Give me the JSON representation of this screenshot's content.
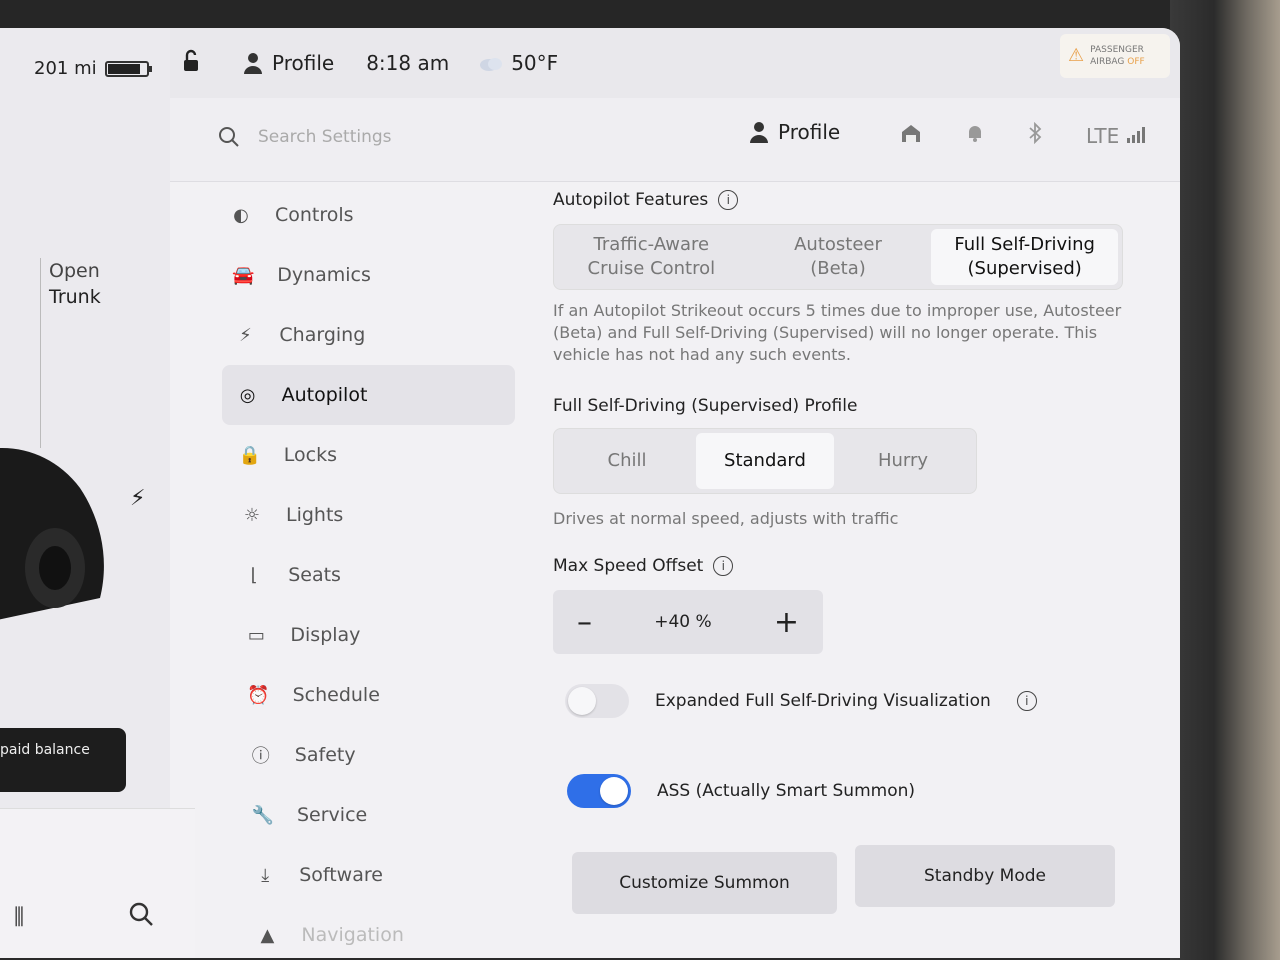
{
  "car_panel": {
    "range": "201 mi",
    "open_trunk_line1": "Open",
    "open_trunk_line2": "Trunk",
    "balance_button": "paid balance"
  },
  "topbar": {
    "profile_label": "Profile",
    "time": "8:18 am",
    "temperature": "50°F",
    "airbag_line1": "PASSENGER",
    "airbag_line2": "AIRBAG",
    "airbag_state": "OFF"
  },
  "settings_header": {
    "search_placeholder": "Search Settings",
    "profile_label": "Profile",
    "signal_label": "LTE"
  },
  "sidebar": {
    "items": [
      {
        "label": "Controls",
        "icon": "toggle-icon"
      },
      {
        "label": "Dynamics",
        "icon": "car-icon"
      },
      {
        "label": "Charging",
        "icon": "bolt-icon"
      },
      {
        "label": "Autopilot",
        "icon": "steering-wheel-icon",
        "active": true
      },
      {
        "label": "Locks",
        "icon": "lock-icon"
      },
      {
        "label": "Lights",
        "icon": "sun-icon"
      },
      {
        "label": "Seats",
        "icon": "seat-icon"
      },
      {
        "label": "Display",
        "icon": "display-icon"
      },
      {
        "label": "Schedule",
        "icon": "alarm-icon"
      },
      {
        "label": "Safety",
        "icon": "alert-icon"
      },
      {
        "label": "Service",
        "icon": "wrench-icon"
      },
      {
        "label": "Software",
        "icon": "download-icon"
      },
      {
        "label": "Navigation",
        "icon": "navigation-icon"
      }
    ]
  },
  "autopilot": {
    "features_title": "Autopilot Features",
    "features_options": [
      {
        "line1": "Traffic-Aware",
        "line2": "Cruise Control"
      },
      {
        "line1": "Autosteer",
        "line2": "(Beta)"
      },
      {
        "line1": "Full Self-Driving",
        "line2": "(Supervised)",
        "selected": true
      }
    ],
    "strikeout_text": "If an Autopilot Strikeout occurs 5 times due to improper use, Autosteer (Beta) and Full Self-Driving (Supervised) will no longer operate. This vehicle has not had any such events.",
    "profile_title": "Full Self-Driving (Supervised) Profile",
    "profile_options": [
      "Chill",
      "Standard",
      "Hurry"
    ],
    "profile_selected": "Standard",
    "profile_desc": "Drives at normal speed, adjusts with traffic",
    "speed_offset_title": "Max Speed Offset",
    "speed_offset_value": "+40 %",
    "minus_label": "–",
    "plus_label": "+",
    "expanded_viz_label": "Expanded Full Self-Driving Visualization",
    "expanded_viz_on": false,
    "ass_label": "ASS (Actually Smart Summon)",
    "ass_on": true,
    "customize_summon_label": "Customize Summon",
    "standby_mode_label": "Standby Mode"
  },
  "colors": {
    "accent_blue": "#2f6fe8",
    "airbag_orange": "#e8a04a"
  }
}
